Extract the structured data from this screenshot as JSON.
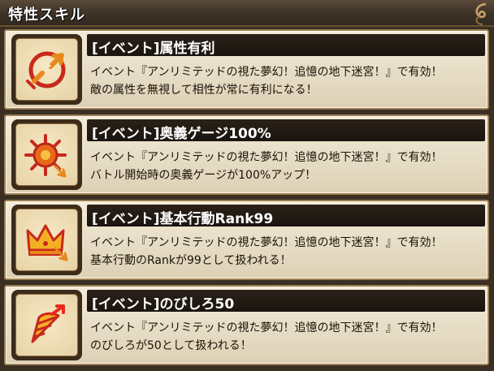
{
  "header": {
    "title": "特性スキル"
  },
  "skills": [
    {
      "icon": "broken-target-arrow-icon",
      "title": "[イベント]属性有利",
      "line1": "イベント『アンリミテッドの視た夢幻！追憶の地下迷宮！』で有効！",
      "line2": "敵の属性を無視して相性が常に有利になる！"
    },
    {
      "icon": "starburst-arrow-icon",
      "title": "[イベント]奥義ゲージ100%",
      "line1": "イベント『アンリミテッドの視た夢幻！追憶の地下迷宮！』で有効！",
      "line2": "バトル開始時の奥義ゲージが100%アップ！"
    },
    {
      "icon": "crown-arrow-icon",
      "title": "[イベント]基本行動Rank99",
      "line1": "イベント『アンリミテッドの視た夢幻！追憶の地下迷宮！』で有効！",
      "line2": "基本行動のRankが99として扱われる！"
    },
    {
      "icon": "drill-arrow-icon",
      "title": "[イベント]のびしろ50",
      "line1": "イベント『アンリミテッドの視た夢幻！追憶の地下迷宮！』で有効！",
      "line2": "のびしろが50として扱われる！"
    }
  ]
}
